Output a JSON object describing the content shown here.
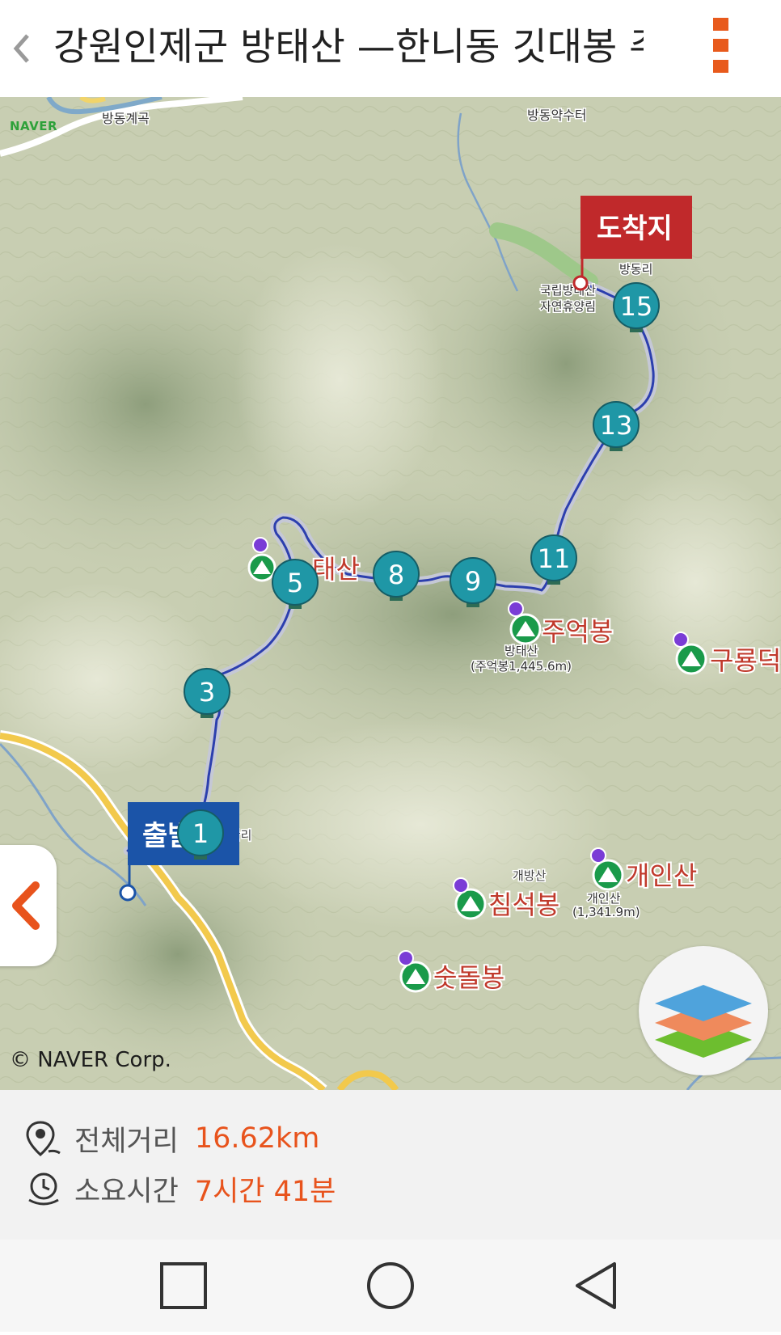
{
  "header": {
    "title": "강원인제군 방태산 —한니동 깃대봉 주"
  },
  "map": {
    "brand": "NAVER",
    "copyright": "© NAVER Corp.",
    "start_label": "출발지",
    "end_label": "도착지",
    "waypoints": [
      "1",
      "3",
      "5",
      "8",
      "9",
      "11",
      "13",
      "15"
    ],
    "places": {
      "bangdong_valley": "방동계곡",
      "bangdong_spring": "방동약수터",
      "bangdong_ri": "방동리",
      "forest_line1": "국립방태산",
      "forest_line2": "자연휴양림",
      "misan_ri": "미산리",
      "gaebang_san": "개방산"
    },
    "peaks": {
      "bangtae": "태산",
      "jueok": "주억봉",
      "jueok_sub1": "방태산",
      "jueok_sub2": "(주억봉1,445.6m)",
      "guryong": "구룡덕",
      "gaein": "개인산",
      "gaein_sub1": "개인산",
      "gaein_sub2": "(1,341.9m)",
      "chimseok": "침석봉",
      "sutdol": "숫돌봉"
    }
  },
  "summary": {
    "distance_label": "전체거리",
    "distance_value": "16.62km",
    "time_label": "소요시간",
    "time_value": "7시간 41분"
  },
  "colors": {
    "accent": "#e8531c",
    "route": "#2c3fae",
    "marker": "#1f97a6",
    "start_flag": "#1b54a8",
    "end_flag": "#c0292b",
    "peak_green": "#1a9a4a"
  },
  "icons": {
    "back": "chevron-left-icon",
    "menu": "kebab-menu-icon",
    "distance": "location-pin-icon",
    "time": "clock-icon",
    "layers": "layers-icon",
    "nav_recent": "square-icon",
    "nav_home": "circle-icon",
    "nav_back": "triangle-back-icon"
  }
}
